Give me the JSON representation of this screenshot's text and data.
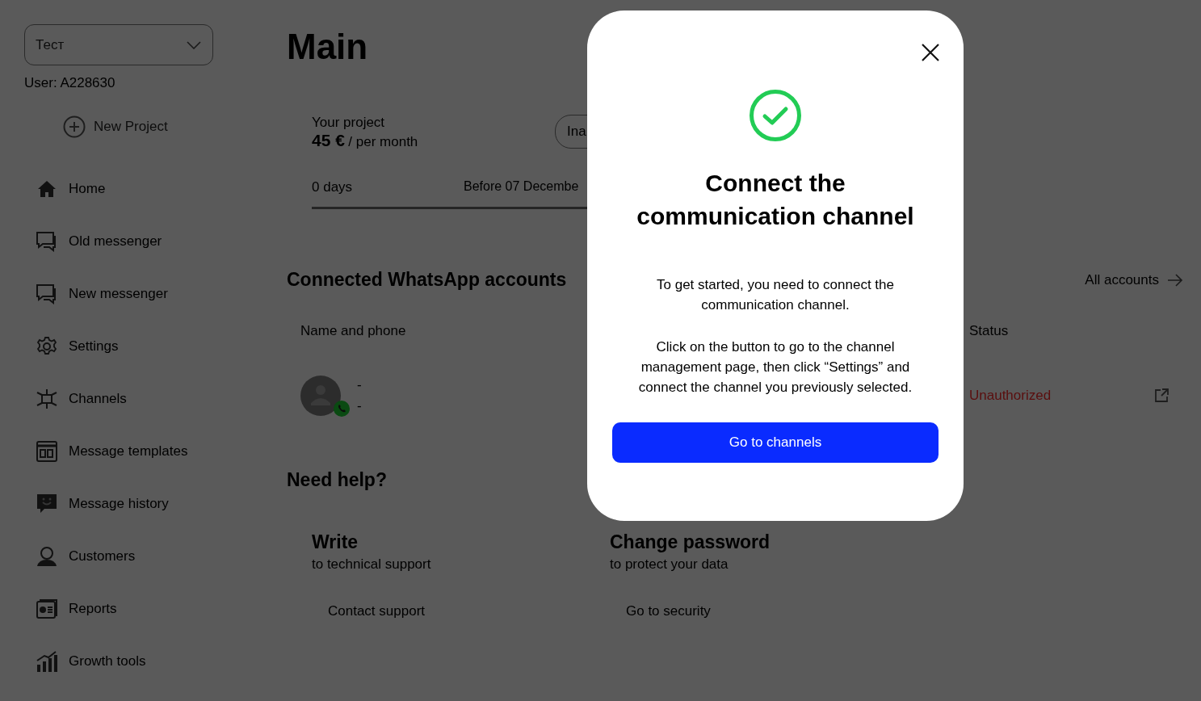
{
  "sidebar": {
    "project_select": {
      "value": "Тест"
    },
    "user": "User: A228630",
    "new_project": "New Project",
    "items": [
      {
        "label": "Home"
      },
      {
        "label": "Old messenger"
      },
      {
        "label": "New messenger"
      },
      {
        "label": "Settings"
      },
      {
        "label": "Channels"
      },
      {
        "label": "Message templates"
      },
      {
        "label": "Message history"
      },
      {
        "label": "Customers"
      },
      {
        "label": "Reports"
      },
      {
        "label": "Growth tools"
      }
    ]
  },
  "main": {
    "title": "Main",
    "project": {
      "label": "Your project",
      "price": "45 €",
      "period": "/ per month",
      "status": "Ina",
      "days": "0 days",
      "until": "Before 07 Decembe"
    },
    "accounts": {
      "title": "Connected WhatsApp accounts",
      "all_link": "All accounts",
      "columns": [
        "Name and phone",
        "Status"
      ],
      "rows": [
        {
          "name": "-",
          "phone": "-",
          "status": "Unauthorized"
        }
      ]
    },
    "help": {
      "title": "Need help?",
      "cards": [
        {
          "title": "Write",
          "subtitle": "to technical support",
          "link": "Contact support"
        },
        {
          "title": "Change password",
          "subtitle": "to protect your data",
          "link": "Go to security"
        }
      ]
    }
  },
  "modal": {
    "title": "Connect the communication channel",
    "paragraphs": [
      "To get started, you need to connect the communication channel.",
      "Click on the button to go to the channel management page, then click “Settings” and connect the channel you previously selected."
    ],
    "button": "Go to channels"
  }
}
